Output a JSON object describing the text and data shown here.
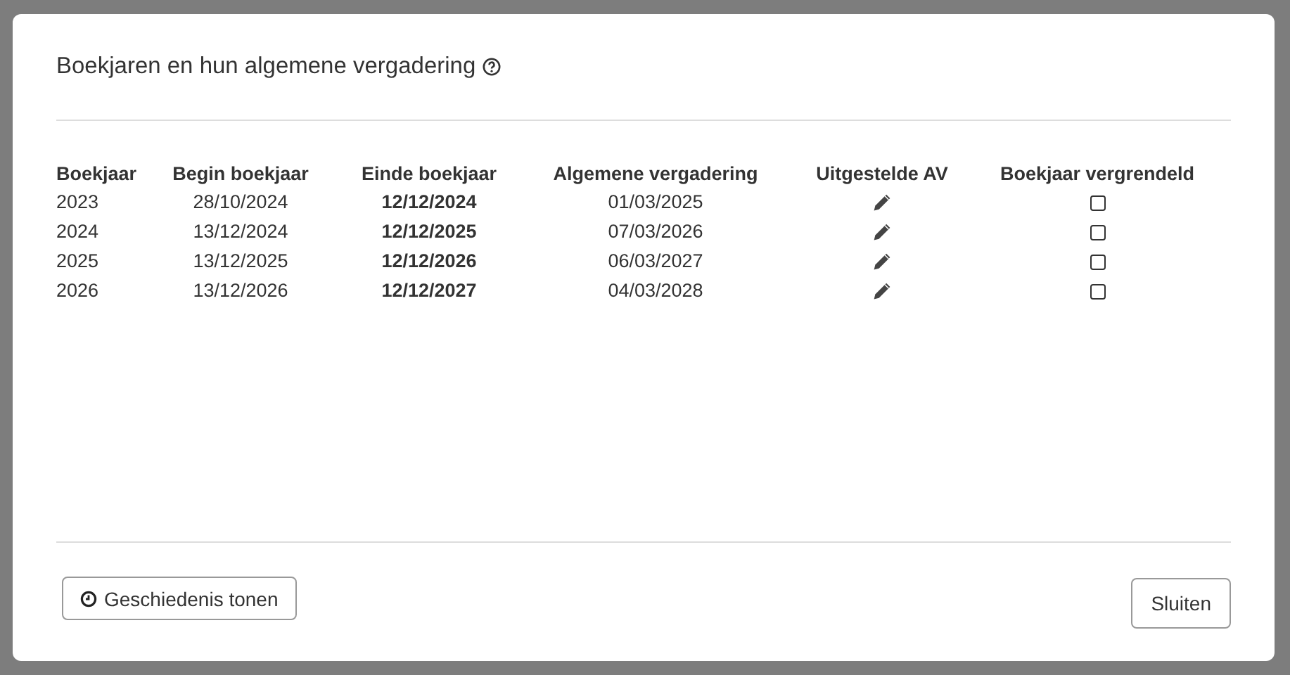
{
  "dialog": {
    "title": "Boekjaren en hun algemene vergadering"
  },
  "table": {
    "columns": [
      "Boekjaar",
      "Begin boekjaar",
      "Einde boekjaar",
      "Algemene vergadering",
      "Uitgestelde AV",
      "Boekjaar vergrendeld"
    ],
    "rows": [
      {
        "year": "2023",
        "begin": "28/10/2024",
        "end": "12/12/2024",
        "meeting": "01/03/2025",
        "locked": false
      },
      {
        "year": "2024",
        "begin": "13/12/2024",
        "end": "12/12/2025",
        "meeting": "07/03/2026",
        "locked": false
      },
      {
        "year": "2025",
        "begin": "13/12/2025",
        "end": "12/12/2026",
        "meeting": "06/03/2027",
        "locked": false
      },
      {
        "year": "2026",
        "begin": "13/12/2026",
        "end": "12/12/2027",
        "meeting": "04/03/2028",
        "locked": false
      }
    ]
  },
  "buttons": [
    {
      "kind": "history",
      "label": "Geschiedenis tonen"
    },
    {
      "kind": "close",
      "label": "Sluiten"
    }
  ]
}
